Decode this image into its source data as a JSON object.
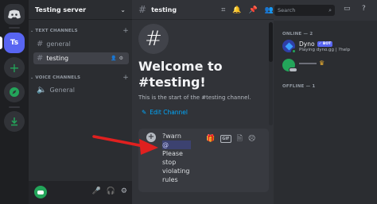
{
  "server": {
    "name": "Testing server",
    "short": "Ts"
  },
  "sidebar": {
    "categories": [
      {
        "label": "TEXT CHANNELS"
      },
      {
        "label": "VOICE CHANNELS"
      }
    ],
    "channels": [
      {
        "label": "general"
      },
      {
        "label": "testing"
      },
      {
        "label": "General"
      }
    ]
  },
  "header": {
    "channel": "testing",
    "search_placeholder": "Search"
  },
  "welcome": {
    "title": "Welcome to #testing!",
    "subtitle": "This is the start of the #testing channel.",
    "edit_label": "Edit Channel"
  },
  "composer": {
    "lines": [
      "?warn",
      "@",
      "Please",
      "stop",
      "violating",
      "rules"
    ],
    "gif_label": "GIF"
  },
  "members": {
    "online_label": "ONLINE — 2",
    "offline_label": "OFFLINE — 1",
    "list": [
      {
        "name": "Dyno",
        "tag": "✓ BOT",
        "status": "Playing dyno.gg | ?help"
      }
    ]
  },
  "colors": {
    "accent": "#5865f2",
    "annotation_arrow": "#e0201f",
    "online": "#23a55a",
    "link": "#00a8fc"
  }
}
